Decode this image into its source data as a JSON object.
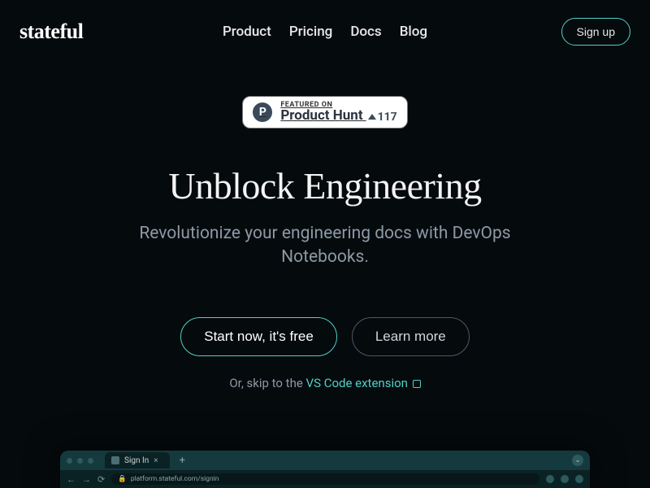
{
  "brand": "stateful",
  "nav": {
    "items": [
      {
        "label": "Product"
      },
      {
        "label": "Pricing"
      },
      {
        "label": "Docs"
      },
      {
        "label": "Blog"
      }
    ],
    "signup": "Sign up"
  },
  "badge": {
    "featured": "FEATURED ON",
    "site": "Product Hunt",
    "count": "117"
  },
  "hero": {
    "headline": "Unblock Engineering",
    "subhead": "Revolutionize your engineering docs with DevOps Notebooks.",
    "cta_primary": "Start now, it's free",
    "cta_secondary": "Learn more",
    "skip_prefix": "Or, skip to the ",
    "skip_link": "VS Code extension"
  },
  "browser": {
    "tab_title": "Sign In",
    "url": "platform.stateful.com/signin"
  },
  "colors": {
    "accent": "#4fd1c5",
    "bg": "#050a0d"
  }
}
